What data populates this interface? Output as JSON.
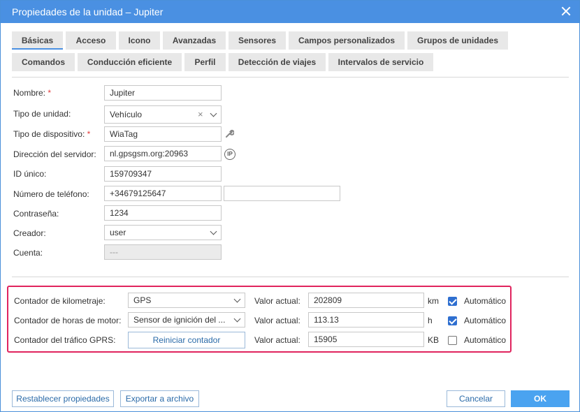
{
  "window": {
    "title": "Propiedades de la unidad – Jupiter"
  },
  "tabs": [
    {
      "label": "Básicas",
      "active": true
    },
    {
      "label": "Acceso"
    },
    {
      "label": "Icono"
    },
    {
      "label": "Avanzadas"
    },
    {
      "label": "Sensores"
    },
    {
      "label": "Campos personalizados"
    },
    {
      "label": "Grupos de unidades"
    },
    {
      "label": "Comandos"
    },
    {
      "label": "Conducción eficiente"
    },
    {
      "label": "Perfil"
    },
    {
      "label": "Detección de viajes"
    },
    {
      "label": "Intervalos de servicio"
    }
  ],
  "form": {
    "name": {
      "label": "Nombre:",
      "required": "*",
      "value": "Jupiter"
    },
    "unit_type": {
      "label": "Tipo de unidad:",
      "value": "Vehículo"
    },
    "device_type": {
      "label": "Tipo de dispositivo:",
      "required": "*",
      "value": "WiaTag"
    },
    "server": {
      "label": "Dirección del servidor:",
      "value": "nl.gpsgsm.org:20963",
      "icon_text": "IP"
    },
    "unique_id": {
      "label": "ID único:",
      "value": "159709347"
    },
    "phone": {
      "label": "Número de teléfono:",
      "value": "+34679125647",
      "value2": ""
    },
    "password": {
      "label": "Contraseña:",
      "value": "1234"
    },
    "creator": {
      "label": "Creador:",
      "value": "user"
    },
    "account": {
      "label": "Cuenta:",
      "value": "---"
    }
  },
  "counters": {
    "mileage": {
      "label": "Contador de kilometraje:",
      "select": "GPS",
      "current_label": "Valor actual:",
      "value": "202809",
      "unit": "km",
      "auto_label": "Automático",
      "auto": true
    },
    "engine": {
      "label": "Contador de horas de motor:",
      "select": "Sensor de ignición del ...",
      "current_label": "Valor actual:",
      "value": "113.13",
      "unit": "h",
      "auto_label": "Automático",
      "auto": true
    },
    "gprs": {
      "label": "Contador del tráfico GPRS:",
      "button": "Reiniciar contador",
      "current_label": "Valor actual:",
      "value": "15905",
      "unit": "KB",
      "auto_label": "Automático",
      "auto": false
    }
  },
  "footer": {
    "reset": "Restablecer propiedades",
    "export": "Exportar a archivo",
    "cancel": "Cancelar",
    "ok": "OK"
  },
  "colors": {
    "titlebar": "#4a90e2",
    "highlight": "#e0245e",
    "primary": "#4aa3f0"
  }
}
